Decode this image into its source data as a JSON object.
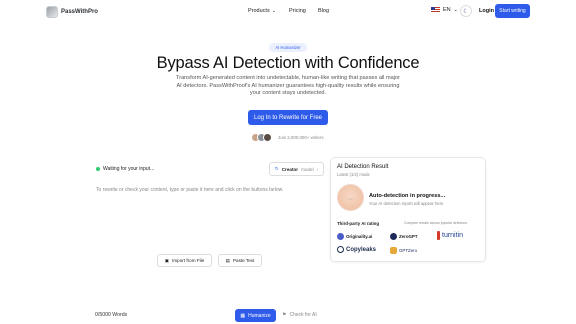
{
  "header": {
    "logo_text": "PassWithPro",
    "nav": [
      {
        "label": "Products",
        "icon": "chevron-down-icon"
      },
      {
        "label": "Pricing"
      },
      {
        "label": "Blog"
      }
    ],
    "language": "EN",
    "login_label": "Login",
    "start_label": "Start writing"
  },
  "hero": {
    "badge": "AI Humanizer",
    "title": "Bypass AI Detection with Confidence",
    "subtitle": "Transform AI-generated content into undetectable, human-like writing that passes all major AI detectors. PassWithProof's AI humanizer guarantees high-quality results while ensuring your content stays undetected.",
    "cta_label": "Log In to Rewrite for Free",
    "users_text": "Join 2,000,000+ writers"
  },
  "editor": {
    "status_text": "Waiting for your input...",
    "model_label": "Creator",
    "model_suffix": "model",
    "placeholder": "To rewrite or check your content, type or paste it here and click on the buttons below.",
    "import_label": "Import from File",
    "paste_label": "Paste Text",
    "word_count": "0/5000 Words",
    "humanize_label": "Humanize",
    "check_label": "Check for AI"
  },
  "result": {
    "title": "AI Detection Result",
    "subtitle": "Latest (1/2) mode",
    "auto_title": "Auto-detection in progress...",
    "auto_sub": "Your AI detection report will appear here",
    "third_party_label": "Third-party AI rating",
    "third_party_note": "Compare results across popular detectors",
    "detectors": [
      "Originality.ai",
      "ZeroGPT",
      "turnitin",
      "Copyleaks",
      "GPTZero"
    ]
  },
  "colors": {
    "accent": "#2f5bea",
    "status_dot": "#2ecc71"
  }
}
